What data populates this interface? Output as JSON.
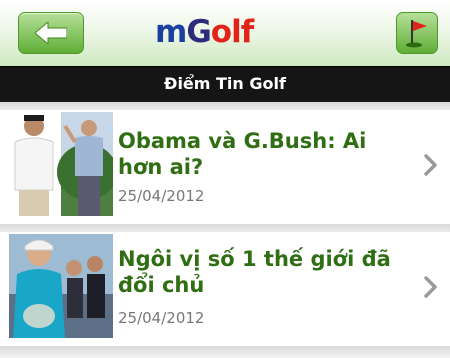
{
  "header": {
    "back_icon": "back-arrow-icon",
    "logo": {
      "m": "m",
      "g": "G",
      "rest": "olf"
    },
    "flag_icon": "golf-flag-icon",
    "colors": {
      "accent_green": "#5fae36",
      "logo_blue": "#1a3fa0",
      "logo_red": "#e2231a"
    }
  },
  "page": {
    "title": "Điểm Tin Golf"
  },
  "articles": [
    {
      "headline": "Obama và G.Bush: Ai hơn ai?",
      "date": "25/04/2012"
    },
    {
      "headline": "Ngôi vị số 1 thế giới đã đổi chủ",
      "date": "25/04/2012"
    }
  ]
}
